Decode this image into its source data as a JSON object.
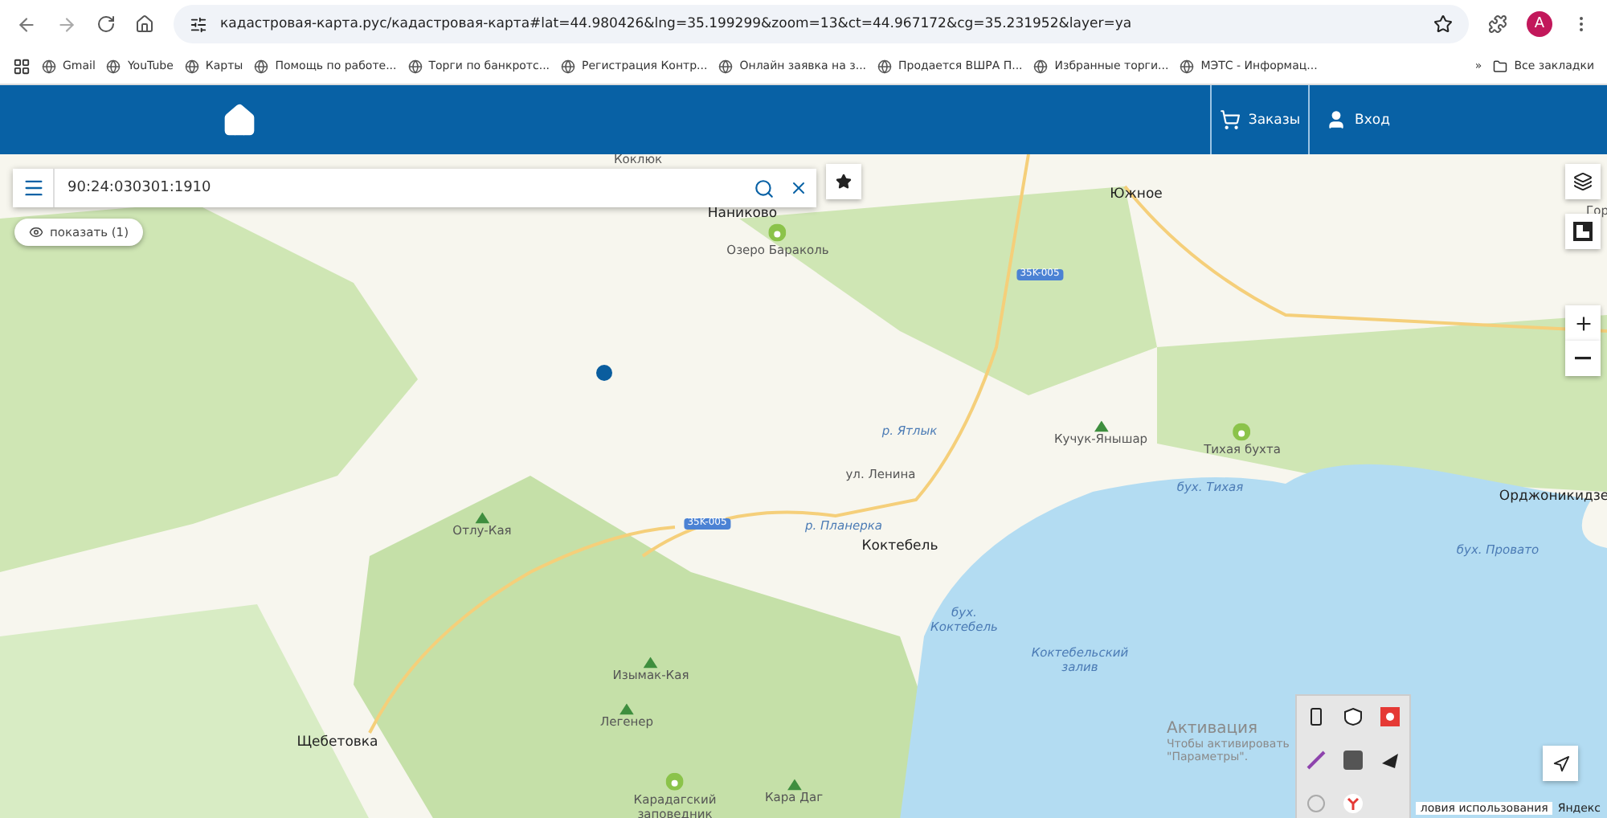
{
  "browser": {
    "url": "кадастровая-карта.рус/кадастровая-карта#lat=44.980426&lng=35.199299&zoom=13&ct=44.967172&cg=35.231952&layer=ya",
    "avatar": "A",
    "bookmarks": [
      {
        "label": "Gmail"
      },
      {
        "label": "YouTube"
      },
      {
        "label": "Карты"
      },
      {
        "label": "Помощь по работе..."
      },
      {
        "label": "Торги по банкротс..."
      },
      {
        "label": "Регистрация Контр..."
      },
      {
        "label": "Онлайн заявка на з..."
      },
      {
        "label": "Продается ВШРА П..."
      },
      {
        "label": "Избранные торги..."
      },
      {
        "label": "МЭТС - Информац..."
      }
    ],
    "more": "»",
    "all_bookmarks": "Все закладки"
  },
  "header": {
    "nav": [
      {
        "label": "Заказы",
        "kind": "cart"
      },
      {
        "label": "Вход",
        "kind": "user"
      }
    ]
  },
  "search": {
    "value": "90:24:030301:1910"
  },
  "show_button": "показать (1)",
  "map": {
    "labels": [
      {
        "text": "Коклюк",
        "kind": "place"
      },
      {
        "text": "Южное",
        "kind": "town"
      },
      {
        "text": "Наниково",
        "kind": "town"
      },
      {
        "text": "Гор",
        "kind": "place"
      },
      {
        "text": "Озеро Бараколь",
        "kind": "park"
      },
      {
        "text": "35K-005",
        "kind": "road"
      },
      {
        "text": "р. Ятлык",
        "kind": "water"
      },
      {
        "text": "Кучук-Янышар",
        "kind": "peak"
      },
      {
        "text": "Тихая бухта",
        "kind": "park"
      },
      {
        "text": "ул. Ленина",
        "kind": "street"
      },
      {
        "text": "бух. Тихая",
        "kind": "water"
      },
      {
        "text": "Орджоникидзе",
        "kind": "town"
      },
      {
        "text": "Отлу-Кая",
        "kind": "peak"
      },
      {
        "text": "35K-005",
        "kind": "road"
      },
      {
        "text": "р. Планерка",
        "kind": "water"
      },
      {
        "text": "Коктебель",
        "kind": "town"
      },
      {
        "text": "бух. Провато",
        "kind": "water"
      },
      {
        "text": "бух.\nКоктебель",
        "kind": "water"
      },
      {
        "text": "Коктебельский\nзалив",
        "kind": "water"
      },
      {
        "text": "Изымак-Кая",
        "kind": "peak"
      },
      {
        "text": "Легенер",
        "kind": "peak"
      },
      {
        "text": "Щебетовка",
        "kind": "town"
      },
      {
        "text": "Карадагский\nзаповедник",
        "kind": "park"
      },
      {
        "text": "Кара Даг",
        "kind": "peak"
      }
    ]
  },
  "windows_activation": {
    "title": "Активация",
    "lines": [
      "Чтобы активировать",
      "\"Параметры\"."
    ]
  },
  "attribution": {
    "terms": "ловия использования",
    "brand": "Яндекс"
  }
}
